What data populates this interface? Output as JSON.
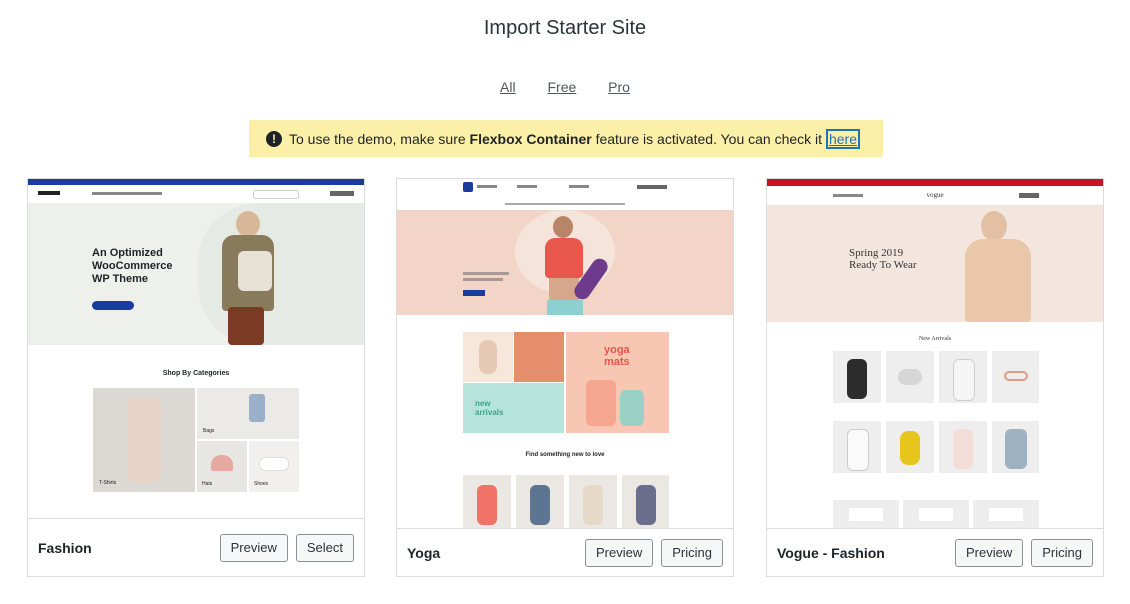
{
  "page": {
    "title": "Import Starter Site"
  },
  "filters": [
    "All",
    "Free",
    "Pro"
  ],
  "notice": {
    "prefix": "To use the demo, make sure ",
    "bold": "Flexbox Container",
    "suffix": " feature is activated. You can check it ",
    "link": "here"
  },
  "cards": [
    {
      "name": "Fashion",
      "buttons": [
        "Preview",
        "Select"
      ],
      "thumb": {
        "hero_heading_1": "An Optimized",
        "hero_heading_2": "WooCommerce",
        "hero_heading_3": "WP Theme",
        "section_title": "Shop By Categories",
        "categories": [
          "T-Shirts",
          "Bags",
          "Hats",
          "Shoes"
        ]
      }
    },
    {
      "name": "Yoga",
      "buttons": [
        "Preview",
        "Pricing"
      ],
      "thumb": {
        "tile_1": "yoga mats",
        "tile_2": "new arrivals",
        "section_title": "Find something new to love"
      }
    },
    {
      "name": "Vogue - Fashion",
      "buttons": [
        "Preview",
        "Pricing"
      ],
      "thumb": {
        "brand": "vogue",
        "hero_1": "Spring 2019",
        "hero_2": "Ready To Wear",
        "section_title": "New Arrivals"
      }
    }
  ],
  "colors": {
    "notice_bg": "#fcf0a8",
    "link": "#2271b1",
    "fashion_bar": "#1a3c9e",
    "yoga_hero": "#f2d5c7",
    "vogue_bar": "#c8151b"
  }
}
